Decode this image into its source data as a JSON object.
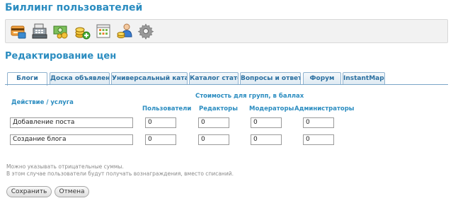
{
  "header": {
    "title": "Биллинг пользователей"
  },
  "toolbar": {
    "icons": [
      "credit-card-icon",
      "cash-register-icon",
      "money-icon",
      "coins-add-icon",
      "calendar-icon",
      "user-coins-icon",
      "gear-icon"
    ]
  },
  "section": {
    "title": "Редактирование цен"
  },
  "tabs": [
    {
      "label": "Блоги",
      "active": true
    },
    {
      "label": "Доска объявлений"
    },
    {
      "label": "Универсальный каталог"
    },
    {
      "label": "Каталог статей"
    },
    {
      "label": "Вопросы и ответы"
    },
    {
      "label": "Форум"
    },
    {
      "label": "InstantMaps"
    }
  ],
  "table": {
    "action_header": "Действие / услуга",
    "group_header": "Стоимость для групп, в баллах",
    "columns": [
      "Пользователи",
      "Редакторы",
      "Модераторы",
      "Администраторы"
    ],
    "rows": [
      {
        "name": "Добавление поста",
        "values": [
          "0",
          "0",
          "0",
          "0"
        ]
      },
      {
        "name": "Создание блога",
        "values": [
          "0",
          "0",
          "0",
          "0"
        ]
      }
    ]
  },
  "notes": {
    "line1": "Можно указывать отрицательные суммы.",
    "line2": "В этом случае пользователи будут получать вознаграждения, вместо списаний."
  },
  "buttons": {
    "save": "Сохранить",
    "cancel": "Отмена"
  }
}
